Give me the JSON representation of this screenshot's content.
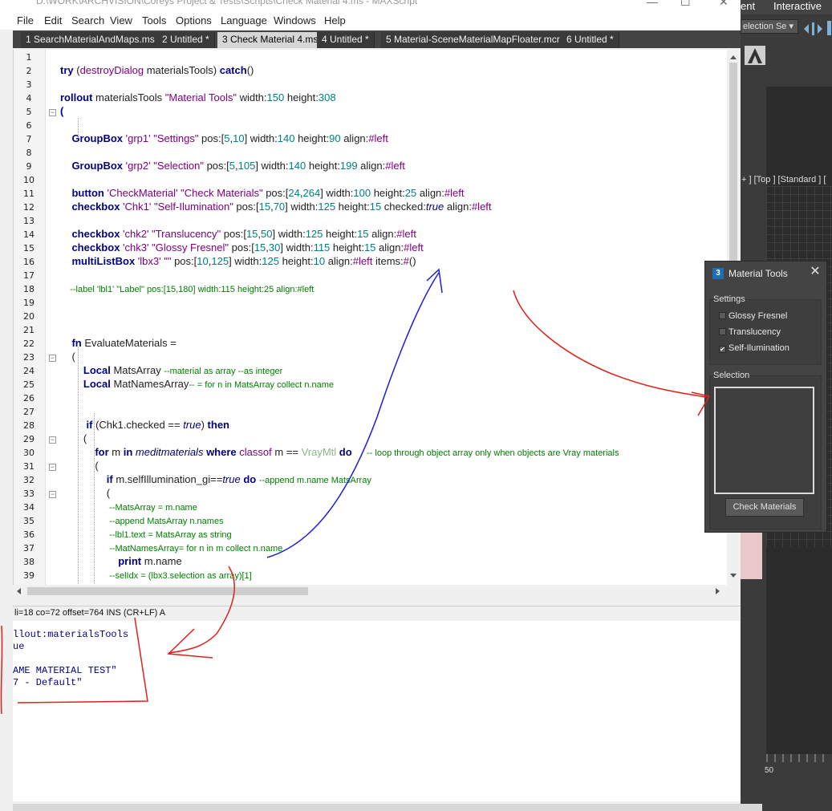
{
  "window": {
    "title": "D:\\WORK\\ARCHVISION\\Coreys Project & Tests\\Scripts\\Check Material 4.ms - MAXScript",
    "min": "—",
    "max": "☐",
    "close": "✕"
  },
  "menu": [
    "File",
    "Edit",
    "Search",
    "View",
    "Tools",
    "Options",
    "Language",
    "Windows",
    "Help"
  ],
  "tabs": [
    {
      "label": "1 SearchMaterialAndMaps.ms *"
    },
    {
      "label": "2 Untitled *"
    },
    {
      "label": "3 Check Material 4.ms"
    },
    {
      "label": "4 Untitled *"
    },
    {
      "label": "5 Material-SceneMaterialMapFloater.mcr *"
    },
    {
      "label": "6 Untitled *"
    }
  ],
  "max_ui": {
    "top_left": "ent",
    "top_right": "Interactive",
    "selection_set": "election Se ▾",
    "viewport_label": "+ ] [Top ] [Standard ] [",
    "ruler_number": "50"
  },
  "code_lines": [
    {
      "n": "1",
      "segs": []
    },
    {
      "n": "2",
      "segs": [
        [
          "kw",
          "try "
        ],
        [
          "pl",
          "("
        ],
        [
          "nm",
          "destroyDialog"
        ],
        [
          "pl",
          " materialsTools) "
        ],
        [
          "kw",
          "catch"
        ],
        [
          "pl",
          "()"
        ]
      ]
    },
    {
      "n": "3",
      "segs": []
    },
    {
      "n": "4",
      "segs": [
        [
          "kw",
          "rollout "
        ],
        [
          "pl",
          "materialsTools "
        ],
        [
          "str",
          "\"Material Tools\""
        ],
        [
          "pl",
          " width:"
        ],
        [
          "num",
          "150"
        ],
        [
          "pl",
          " height:"
        ],
        [
          "num",
          "308"
        ]
      ]
    },
    {
      "n": "5",
      "segs": [
        [
          "kw",
          "("
        ]
      ]
    },
    {
      "n": "6",
      "segs": []
    },
    {
      "n": "7",
      "segs": [
        [
          "kw",
          "    GroupBox "
        ],
        [
          "str",
          "'grp1' "
        ],
        [
          "nm",
          "\"Settings\""
        ],
        [
          "pl",
          " pos:["
        ],
        [
          "num",
          "5"
        ],
        [
          "pl",
          ","
        ],
        [
          "num",
          "10"
        ],
        [
          "pl",
          "] width:"
        ],
        [
          "num",
          "140"
        ],
        [
          "pl",
          " height:"
        ],
        [
          "num",
          "90"
        ],
        [
          "pl",
          " align:"
        ],
        [
          "nm",
          "#left"
        ]
      ]
    },
    {
      "n": "8",
      "segs": []
    },
    {
      "n": "9",
      "segs": [
        [
          "kw",
          "    GroupBox "
        ],
        [
          "str",
          "'grp2' "
        ],
        [
          "nm",
          "\"Selection\""
        ],
        [
          "pl",
          " pos:["
        ],
        [
          "num",
          "5"
        ],
        [
          "pl",
          ","
        ],
        [
          "num",
          "105"
        ],
        [
          "pl",
          "] width:"
        ],
        [
          "num",
          "140"
        ],
        [
          "pl",
          " height:"
        ],
        [
          "num",
          "199"
        ],
        [
          "pl",
          " align:"
        ],
        [
          "nm",
          "#left"
        ]
      ]
    },
    {
      "n": "10",
      "segs": []
    },
    {
      "n": "11",
      "segs": [
        [
          "kw",
          "    button "
        ],
        [
          "str",
          "'CheckMaterial' "
        ],
        [
          "nm",
          "\"Check Materials\""
        ],
        [
          "pl",
          " pos:["
        ],
        [
          "num",
          "24"
        ],
        [
          "pl",
          ","
        ],
        [
          "num",
          "264"
        ],
        [
          "pl",
          "] width:"
        ],
        [
          "num",
          "100"
        ],
        [
          "pl",
          " height:"
        ],
        [
          "num",
          "25"
        ],
        [
          "pl",
          " align:"
        ],
        [
          "nm",
          "#left"
        ]
      ]
    },
    {
      "n": "12",
      "segs": [
        [
          "kw",
          "    checkbox "
        ],
        [
          "str",
          "'Chk1' "
        ],
        [
          "nm",
          "\"Self-Ilumination\""
        ],
        [
          "pl",
          " pos:["
        ],
        [
          "num",
          "15"
        ],
        [
          "pl",
          ","
        ],
        [
          "num",
          "70"
        ],
        [
          "pl",
          "] width:"
        ],
        [
          "num",
          "125"
        ],
        [
          "pl",
          " height:"
        ],
        [
          "num",
          "15"
        ],
        [
          "pl",
          " checked:"
        ],
        [
          "it",
          "true"
        ],
        [
          "pl",
          " align:"
        ],
        [
          "nm",
          "#left"
        ]
      ]
    },
    {
      "n": "13",
      "segs": []
    },
    {
      "n": "14",
      "segs": [
        [
          "kw",
          "    checkbox "
        ],
        [
          "str",
          "'chk2' "
        ],
        [
          "nm",
          "\"Translucency\""
        ],
        [
          "pl",
          " pos:["
        ],
        [
          "num",
          "15"
        ],
        [
          "pl",
          ","
        ],
        [
          "num",
          "50"
        ],
        [
          "pl",
          "] width:"
        ],
        [
          "num",
          "125"
        ],
        [
          "pl",
          " height:"
        ],
        [
          "num",
          "15"
        ],
        [
          "pl",
          " align:"
        ],
        [
          "nm",
          "#left"
        ]
      ]
    },
    {
      "n": "15",
      "segs": [
        [
          "kw",
          "    checkbox "
        ],
        [
          "str",
          "'chk3' "
        ],
        [
          "nm",
          "\"Glossy Fresnel\""
        ],
        [
          "pl",
          " pos:["
        ],
        [
          "num",
          "15"
        ],
        [
          "pl",
          ","
        ],
        [
          "num",
          "30"
        ],
        [
          "pl",
          "] width:"
        ],
        [
          "num",
          "115"
        ],
        [
          "pl",
          " height:"
        ],
        [
          "num",
          "15"
        ],
        [
          "pl",
          " align:"
        ],
        [
          "nm",
          "#left"
        ]
      ]
    },
    {
      "n": "16",
      "segs": [
        [
          "kw",
          "    multiListBox "
        ],
        [
          "str",
          "'lbx3' "
        ],
        [
          "nm",
          "\"\""
        ],
        [
          "pl",
          " pos:["
        ],
        [
          "num",
          "10"
        ],
        [
          "pl",
          ","
        ],
        [
          "num",
          "125"
        ],
        [
          "pl",
          "] width:"
        ],
        [
          "num",
          "125"
        ],
        [
          "pl",
          " height:"
        ],
        [
          "num",
          "10"
        ],
        [
          "pl",
          " align:"
        ],
        [
          "nm",
          "#left"
        ],
        [
          "pl",
          " items:"
        ],
        [
          "nm",
          "#"
        ],
        [
          "pl",
          "()"
        ]
      ]
    },
    {
      "n": "17",
      "segs": []
    },
    {
      "n": "18",
      "segs": [
        [
          "cm",
          "    --label 'lbl1' \"Label\" pos:[15,180] width:115 height:25 align:#left"
        ]
      ]
    },
    {
      "n": "19",
      "segs": []
    },
    {
      "n": "20",
      "segs": []
    },
    {
      "n": "21",
      "segs": []
    },
    {
      "n": "22",
      "segs": [
        [
          "kw",
          "    fn "
        ],
        [
          "pl",
          "EvaluateMaterials ="
        ]
      ]
    },
    {
      "n": "23",
      "segs": [
        [
          "pl",
          "    ("
        ]
      ]
    },
    {
      "n": "24",
      "segs": [
        [
          "kw",
          "        Local "
        ],
        [
          "pl",
          "MatsArray "
        ],
        [
          "cm",
          "--material as array --as integer"
        ]
      ]
    },
    {
      "n": "25",
      "segs": [
        [
          "kw",
          "        Local "
        ],
        [
          "pl",
          "MatNamesArray"
        ],
        [
          "cm",
          "-- = for n in MatsArray collect n.name"
        ]
      ]
    },
    {
      "n": "26",
      "segs": []
    },
    {
      "n": "27",
      "segs": []
    },
    {
      "n": "28",
      "segs": [
        [
          "kw",
          "         if "
        ],
        [
          "pl",
          "(Chk1.checked == "
        ],
        [
          "it",
          "true"
        ],
        [
          "pl",
          ") "
        ],
        [
          "kw",
          "then"
        ]
      ]
    },
    {
      "n": "29",
      "segs": [
        [
          "pl",
          "        ("
        ]
      ]
    },
    {
      "n": "30",
      "segs": [
        [
          "kw",
          "            for "
        ],
        [
          "pl",
          "m "
        ],
        [
          "kw",
          "in "
        ],
        [
          "it",
          "meditmaterials "
        ],
        [
          "kw",
          "where "
        ],
        [
          "nm",
          "classof "
        ],
        [
          "pl",
          "m == "
        ],
        [
          "gy",
          "VrayMtl "
        ],
        [
          "kw",
          "do"
        ],
        [
          "cm",
          "      -- loop through object array only when objects are Vray materials"
        ]
      ]
    },
    {
      "n": "31",
      "segs": [
        [
          "pl",
          "            ("
        ]
      ]
    },
    {
      "n": "32",
      "segs": [
        [
          "kw",
          "                if "
        ],
        [
          "pl",
          "m.selfIllumination_gi=="
        ],
        [
          "it",
          "true "
        ],
        [
          "kw",
          "do "
        ],
        [
          "cm",
          "--append m.name MatsArray"
        ]
      ]
    },
    {
      "n": "33",
      "segs": [
        [
          "pl",
          "                ("
        ]
      ]
    },
    {
      "n": "34",
      "segs": [
        [
          "cm",
          "                    --MatsArray = m.name"
        ]
      ]
    },
    {
      "n": "35",
      "segs": [
        [
          "cm",
          "                    --append MatsArray n.names"
        ]
      ]
    },
    {
      "n": "36",
      "segs": [
        [
          "cm",
          "                    --lbl1.text = MatsArray as string"
        ]
      ]
    },
    {
      "n": "37",
      "segs": [
        [
          "cm",
          "                    --MatNamesArray= for n in m collect n.name"
        ]
      ]
    },
    {
      "n": "38",
      "segs": [
        [
          "kw",
          "                    print "
        ],
        [
          "pl",
          "m.name"
        ]
      ]
    },
    {
      "n": "39",
      "segs": [
        [
          "cm",
          "                    --selIdx = (lbx3.selection as array)[1]"
        ]
      ]
    }
  ],
  "status": "li=18 co=72 offset=764 INS (CR+LF) A",
  "output_lines": [
    "llout:materialsTools",
    "ue",
    "",
    "AME MATERIAL TEST\"",
    "7 - Default\""
  ],
  "dialog": {
    "title": "Material Tools",
    "icon": "3",
    "settings_label": "Settings",
    "checkboxes": [
      {
        "label": "Glossy Fresnel",
        "checked": false
      },
      {
        "label": "Translucency",
        "checked": false
      },
      {
        "label": "Self-Ilumination",
        "checked": true
      }
    ],
    "selection_label": "Selection",
    "button": "Check Materials"
  },
  "colors": {
    "keyword": "#000080",
    "string": "#800080",
    "number": "#008080",
    "comment": "#008000",
    "annotation_red": "#e0201a",
    "annotation_blue": "#1a1ae0",
    "dialog_bg": "#444444"
  }
}
